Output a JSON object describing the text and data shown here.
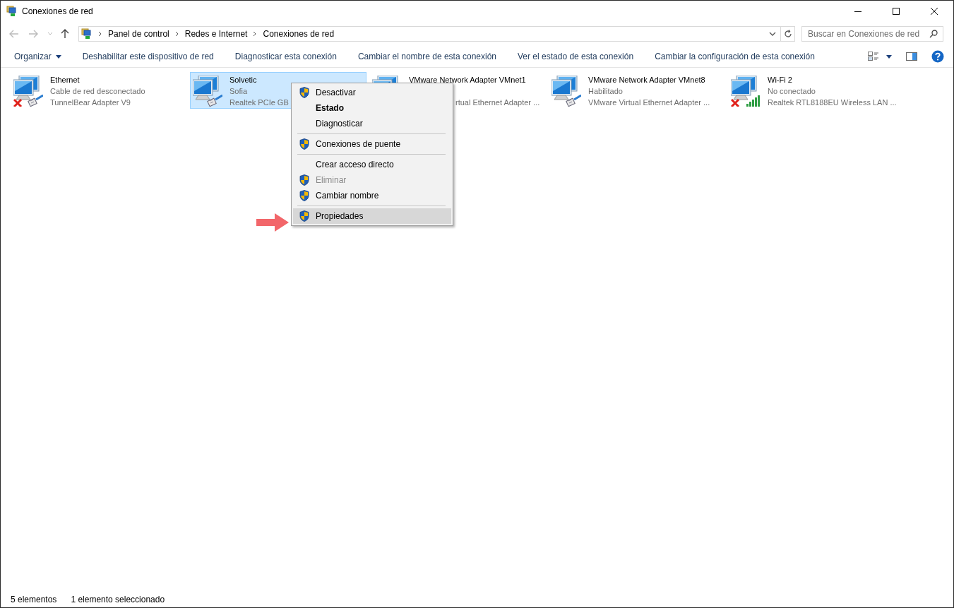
{
  "window": {
    "title": "Conexiones de red"
  },
  "address_bar": {
    "breadcrumbs": [
      "Panel de control",
      "Redes e Internet",
      "Conexiones de red"
    ]
  },
  "search": {
    "placeholder": "Buscar en Conexiones de red"
  },
  "toolbar": {
    "items": [
      {
        "kind": "menu",
        "label": "Organizar"
      },
      {
        "kind": "button",
        "label": "Deshabilitar este dispositivo de red"
      },
      {
        "kind": "button",
        "label": "Diagnosticar esta conexión"
      },
      {
        "kind": "button",
        "label": "Cambiar el nombre de esta conexión"
      },
      {
        "kind": "button",
        "label": "Ver el estado de esta conexión"
      },
      {
        "kind": "button",
        "label": "Cambiar la configuración de esta conexión"
      }
    ]
  },
  "connections": [
    {
      "name": "Ethernet",
      "status": "Cable de red desconectado",
      "adapter": "TunnelBear Adapter V9",
      "kind": "cable",
      "disconnected": true,
      "selected": false,
      "covered": false
    },
    {
      "name": "Solvetic",
      "status": "Sofia",
      "adapter": "Realtek PCIe GB",
      "kind": "cable",
      "disconnected": false,
      "selected": true,
      "covered": false
    },
    {
      "name": "VMware Network Adapter VMnet1",
      "adapter": "rtual Ethernet Adapter ...",
      "kind": "cable",
      "disconnected": false,
      "selected": false,
      "covered": true
    },
    {
      "name": "VMware Network Adapter VMnet8",
      "status": "Habilitado",
      "adapter": "VMware Virtual Ethernet Adapter ...",
      "kind": "cable",
      "disconnected": false,
      "selected": false,
      "covered": false
    },
    {
      "name": "Wi-Fi 2",
      "status": "No conectado",
      "adapter": "Realtek RTL8188EU Wireless LAN ...",
      "kind": "wireless",
      "disconnected": true,
      "selected": false,
      "covered": false
    }
  ],
  "context_menu": {
    "items": [
      {
        "kind": "item",
        "label": "Desactivar",
        "shield": true,
        "default": false,
        "disabled": false,
        "selected": false
      },
      {
        "kind": "item",
        "label": "Estado",
        "shield": false,
        "default": true,
        "disabled": false,
        "selected": false
      },
      {
        "kind": "item",
        "label": "Diagnosticar",
        "shield": false,
        "default": false,
        "disabled": false,
        "selected": false
      },
      {
        "kind": "separator"
      },
      {
        "kind": "item",
        "label": "Conexiones de puente",
        "shield": true,
        "default": false,
        "disabled": false,
        "selected": false
      },
      {
        "kind": "separator"
      },
      {
        "kind": "item",
        "label": "Crear acceso directo",
        "shield": false,
        "default": false,
        "disabled": false,
        "selected": false
      },
      {
        "kind": "item",
        "label": "Eliminar",
        "shield": true,
        "default": false,
        "disabled": true,
        "selected": false
      },
      {
        "kind": "item",
        "label": "Cambiar nombre",
        "shield": true,
        "default": false,
        "disabled": false,
        "selected": false
      },
      {
        "kind": "separator"
      },
      {
        "kind": "item",
        "label": "Propiedades",
        "shield": true,
        "default": false,
        "disabled": false,
        "selected": true
      }
    ]
  },
  "status_bar": {
    "count": "5 elementos",
    "selection": "1 elemento seleccionado"
  }
}
